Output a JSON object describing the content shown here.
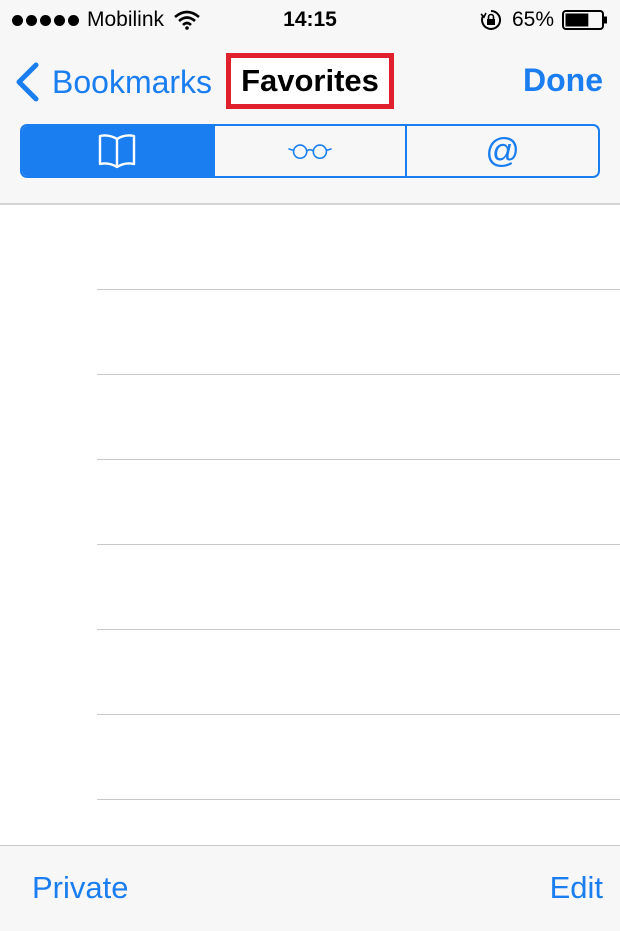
{
  "status_bar": {
    "carrier": "Mobilink",
    "time": "14:15",
    "battery_percent": "65%",
    "battery_level": 0.65,
    "signal_bars": 5,
    "icons": [
      "wifi-icon",
      "orientation-lock-icon",
      "battery-icon"
    ]
  },
  "nav": {
    "back_label": "Bookmarks",
    "title": "Favorites",
    "done_label": "Done"
  },
  "segments": [
    {
      "icon": "book-icon",
      "selected": true
    },
    {
      "icon": "glasses-icon",
      "selected": false
    },
    {
      "label": "@",
      "icon": "at-icon",
      "selected": false
    }
  ],
  "list": {
    "row_count": 8
  },
  "toolbar": {
    "private_label": "Private",
    "edit_label": "Edit"
  },
  "colors": {
    "accent": "#1a7ef0",
    "highlight_box": "#e0202c",
    "bar_background": "#f7f7f7",
    "separator": "#c8c7cc"
  }
}
